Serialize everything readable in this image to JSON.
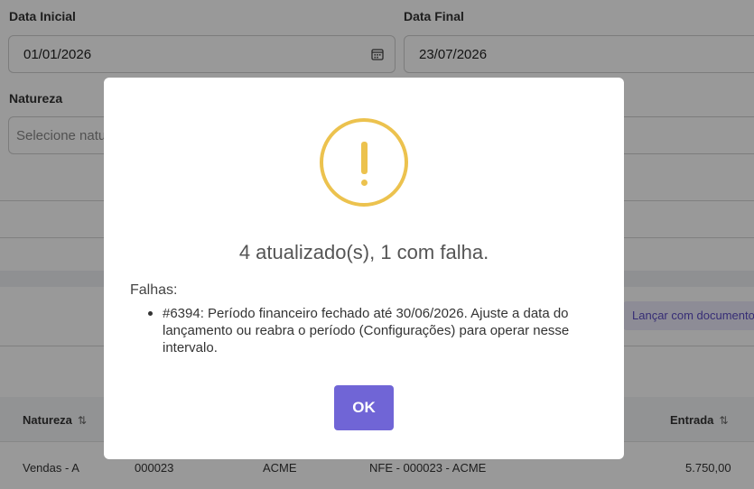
{
  "filters": {
    "data_inicial_label": "Data Inicial",
    "data_inicial_value": "01/01/2026",
    "data_final_label": "Data Final",
    "data_final_value": "23/07/2026",
    "natureza_label": "Natureza",
    "natureza_placeholder": "Selecione natureza"
  },
  "actions": {
    "lancar_label": "Lançar com documento"
  },
  "table": {
    "headers": [
      "Natureza",
      "Entrada"
    ],
    "sort_icon": "⇅",
    "rows": [
      [
        "Vendas - A",
        "000023",
        "ACME",
        "NFE - 000023 - ACME",
        "5.750,00"
      ]
    ]
  },
  "modal": {
    "icon": "warning-icon",
    "icon_color": "#ecc24e",
    "title": "4 atualizado(s), 1 com falha.",
    "failures_heading": "Falhas:",
    "failures": [
      "#6394: Período financeiro fechado até 30/06/2026. Ajuste a data do lançamento ou reabra o período (Configurações) para operar nesse intervalo."
    ],
    "ok_label": "OK",
    "ok_color": "#7065d6"
  }
}
